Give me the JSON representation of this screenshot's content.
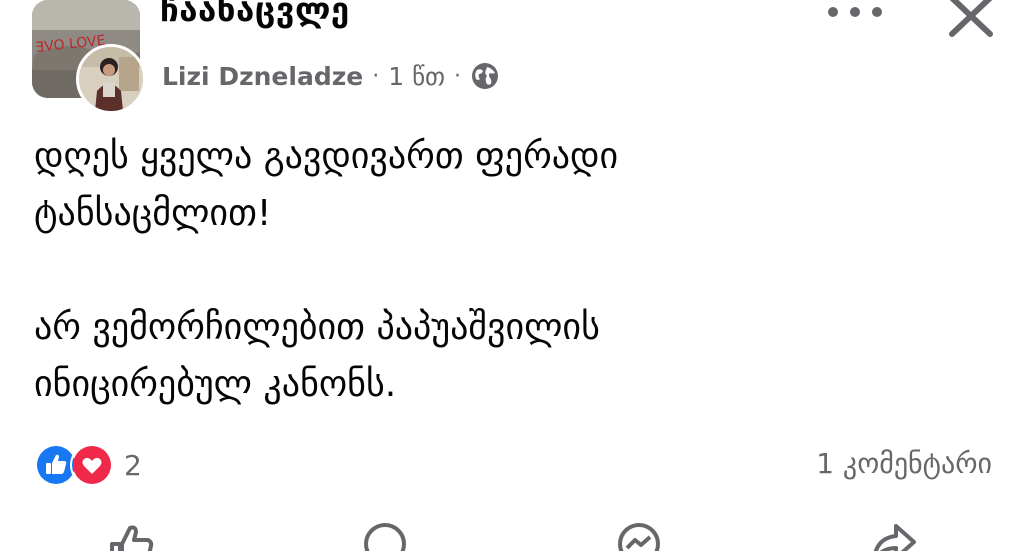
{
  "header": {
    "group_name": "ჩაანაცვლე",
    "author_name": "Lizi Dzneladze",
    "separator": "·",
    "timestamp": "1 წთ",
    "privacy_icon": "globe-icon",
    "more_icon": "more-horizontal-icon",
    "close_icon": "close-icon",
    "avatar_graffiti_text": "ƎVO LOVE"
  },
  "post": {
    "paragraph_1": {
      "line_1": "დღეს ყველა გავდივართ ფერადი",
      "line_2": "ტანსაცმლით!"
    },
    "paragraph_2": {
      "line_1": "არ ვემორჩილებით პაპუაშვილის",
      "line_2": "ინიცირებულ კანონს."
    }
  },
  "engagement": {
    "reaction_icons": [
      "like-icon",
      "love-icon"
    ],
    "reaction_count": "2",
    "comment_count": "1 კომენტარი"
  },
  "actions": [
    {
      "icon": "like-icon"
    },
    {
      "icon": "comment-icon"
    },
    {
      "icon": "messenger-icon"
    },
    {
      "icon": "share-icon"
    }
  ],
  "colors": {
    "text_primary": "#050505",
    "text_secondary": "#65676b",
    "like_blue": "#1877f2",
    "love_red": "#f02849",
    "background": "#ffffff"
  }
}
